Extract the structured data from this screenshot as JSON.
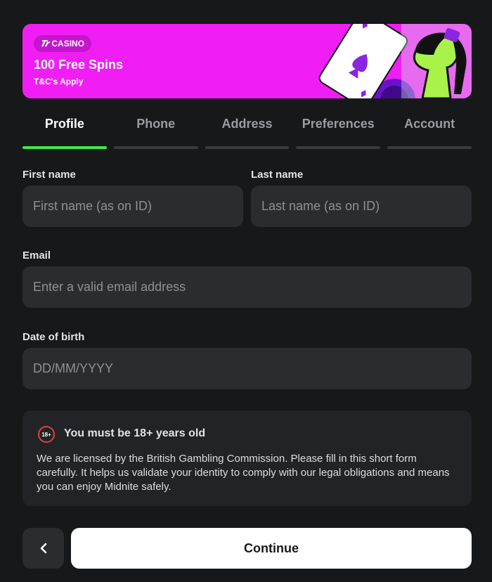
{
  "banner": {
    "badge_logo": "𝑻𝒓",
    "badge_label": "CASINO",
    "title": "100 Free Spins",
    "terms": "T&C's Apply",
    "background_color": "#f01ef5"
  },
  "tabs": [
    {
      "label": "Profile",
      "active": true
    },
    {
      "label": "Phone",
      "active": false
    },
    {
      "label": "Address",
      "active": false
    },
    {
      "label": "Preferences",
      "active": false
    },
    {
      "label": "Account",
      "active": false
    }
  ],
  "form": {
    "first_name": {
      "label": "First name",
      "placeholder": "First name (as on ID)",
      "value": ""
    },
    "last_name": {
      "label": "Last name",
      "placeholder": "Last name (as on ID)",
      "value": ""
    },
    "email": {
      "label": "Email",
      "placeholder": "Enter a valid email address",
      "value": ""
    },
    "dob": {
      "label": "Date of birth",
      "placeholder": "DD/MM/YYYY",
      "value": ""
    }
  },
  "notice": {
    "icon_text": "18+",
    "title": "You must be 18+ years old",
    "body": "We are licensed by the British Gambling Commission. Please fill in this short form carefully. It helps us validate your identity to comply with our legal obligations and means you can enjoy Midnite safely."
  },
  "footer": {
    "back_icon": "chevron-left-icon",
    "continue_label": "Continue"
  },
  "colors": {
    "accent_tab": "#3ee84a",
    "background": "#17181a",
    "field": "#2b2c2f",
    "warning": "#e0413b"
  }
}
